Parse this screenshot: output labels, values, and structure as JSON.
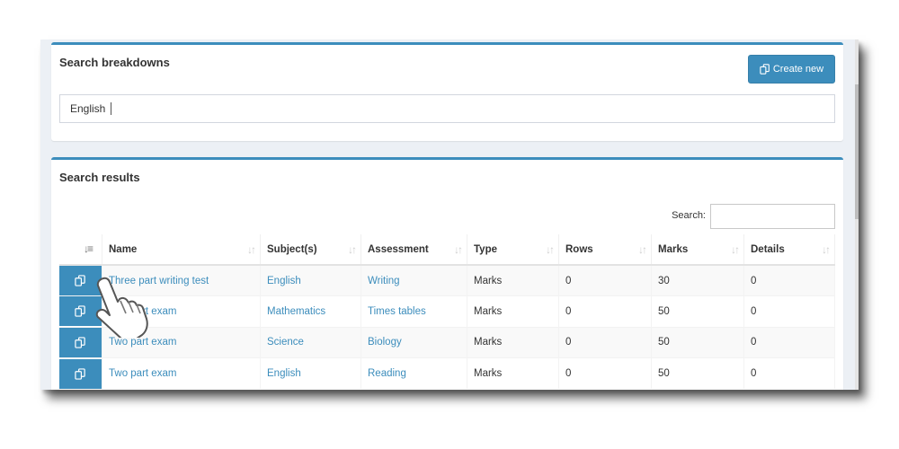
{
  "breakdowns": {
    "title": "Search breakdowns",
    "create_label": "Create new",
    "search_value": "English"
  },
  "results": {
    "title": "Search results",
    "search_label": "Search:",
    "columns": [
      "Name",
      "Subject(s)",
      "Assessment",
      "Type",
      "Rows",
      "Marks",
      "Details"
    ],
    "rows": [
      {
        "name": "Three part writing test",
        "subject": "English",
        "assessment": "Writing",
        "type": "Marks",
        "rows": "0",
        "marks": "30",
        "details": "0"
      },
      {
        "name": "Two part exam",
        "subject": "Mathematics",
        "assessment": "Times tables",
        "type": "Marks",
        "rows": "0",
        "marks": "50",
        "details": "0"
      },
      {
        "name": "Two part exam",
        "subject": "Science",
        "assessment": "Biology",
        "type": "Marks",
        "rows": "0",
        "marks": "50",
        "details": "0"
      },
      {
        "name": "Two part exam",
        "subject": "English",
        "assessment": "Reading",
        "type": "Marks",
        "rows": "0",
        "marks": "50",
        "details": "0"
      }
    ]
  },
  "icons": {
    "copy": "copy-icon",
    "sort": "sort-icon",
    "cursor": "hand-pointer-icon"
  },
  "colors": {
    "accent": "#3c8dbc",
    "background": "#ecf0f5"
  }
}
